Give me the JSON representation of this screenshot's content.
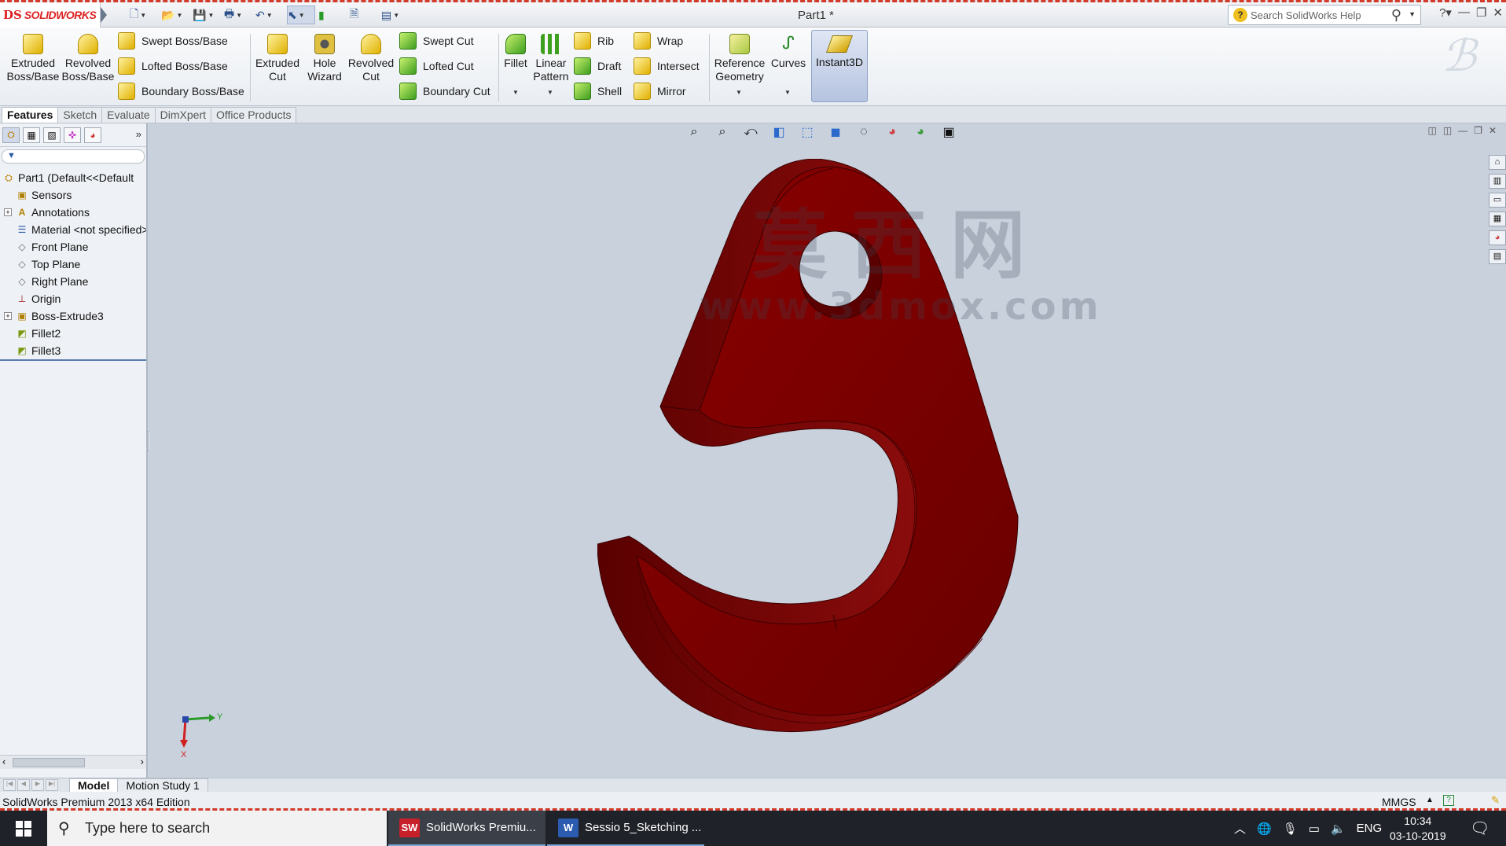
{
  "app": {
    "logo_prefix": "DS",
    "logo_text": "SOLIDWORKS",
    "document_title": "Part1 *",
    "search_placeholder": "Search SolidWorks Help"
  },
  "ribbon": {
    "extruded_boss": "Extruded\nBoss/Base",
    "revolved_boss": "Revolved\nBoss/Base",
    "swept_boss": "Swept Boss/Base",
    "lofted_boss": "Lofted Boss/Base",
    "boundary_boss": "Boundary Boss/Base",
    "extruded_cut": "Extruded\nCut",
    "hole_wizard": "Hole\nWizard",
    "revolved_cut": "Revolved\nCut",
    "swept_cut": "Swept Cut",
    "lofted_cut": "Lofted Cut",
    "boundary_cut": "Boundary Cut",
    "fillet": "Fillet",
    "linear_pattern": "Linear\nPattern",
    "rib": "Rib",
    "draft": "Draft",
    "shell": "Shell",
    "wrap": "Wrap",
    "intersect": "Intersect",
    "mirror": "Mirror",
    "reference_geometry": "Reference\nGeometry",
    "curves": "Curves",
    "instant3d": "Instant3D"
  },
  "command_tabs": [
    "Features",
    "Sketch",
    "Evaluate",
    "DimXpert",
    "Office Products"
  ],
  "tree": {
    "root": "Part1  (Default<<Default",
    "items": [
      {
        "label": "Sensors",
        "icon": "sensor-icon"
      },
      {
        "label": "Annotations",
        "icon": "annotations-icon"
      },
      {
        "label": "Material <not specified>",
        "icon": "material-icon"
      },
      {
        "label": "Front Plane",
        "icon": "plane-icon"
      },
      {
        "label": "Top Plane",
        "icon": "plane-icon"
      },
      {
        "label": "Right Plane",
        "icon": "plane-icon"
      },
      {
        "label": "Origin",
        "icon": "origin-icon"
      },
      {
        "label": "Boss-Extrude3",
        "icon": "extrude-feature-icon"
      },
      {
        "label": "Fillet2",
        "icon": "fillet-feature-icon"
      },
      {
        "label": "Fillet3",
        "icon": "fillet-feature-icon"
      }
    ]
  },
  "triad": {
    "y": "Y",
    "x": "X"
  },
  "watermark": {
    "line1": "莫西网",
    "line2": "www.3dmox.com"
  },
  "bottom_tabs": [
    "Model",
    "Motion Study 1"
  ],
  "status": {
    "left": "SolidWorks Premium 2013 x64 Edition",
    "units": "MMGS",
    "units_arrow": "▲",
    "help": "?"
  },
  "taskbar": {
    "search_placeholder": "Type here to search",
    "apps": [
      {
        "label": "SolidWorks Premiu...",
        "icon_text": "SW"
      },
      {
        "label": "Sessio 5_Sketching ...",
        "icon_text": "W"
      }
    ],
    "language": "ENG",
    "time": "10:34",
    "date": "03-10-2019"
  },
  "colors": {
    "part_body": "#7a0000",
    "part_edge": "#3a0000",
    "viewport_bg": "#c9d1dd",
    "accent_dash": "#d23a2a"
  }
}
